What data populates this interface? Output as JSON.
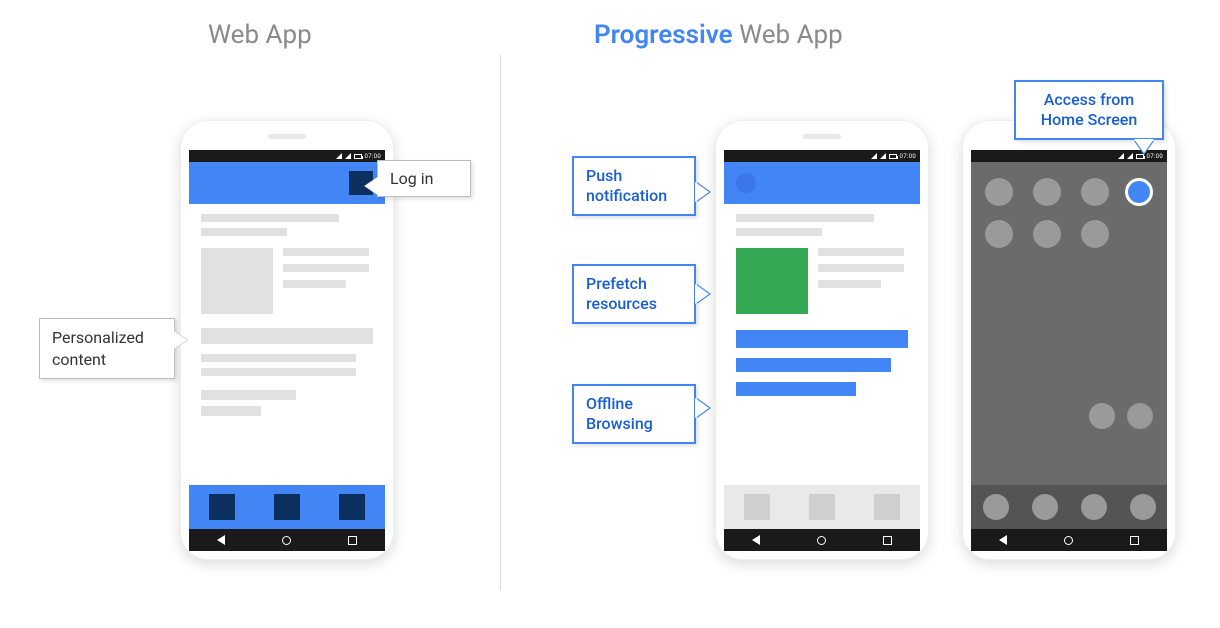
{
  "headings": {
    "left": "Web App",
    "right_accent": "Progressive",
    "right_rest": " Web App"
  },
  "status": {
    "time": "07:00"
  },
  "callouts": {
    "login": "Log in",
    "personalized": "Personalized content",
    "push": "Push notification",
    "prefetch": "Prefetch resources",
    "offline": "Offline Browsing",
    "homescreen": "Access from Home Screen"
  }
}
